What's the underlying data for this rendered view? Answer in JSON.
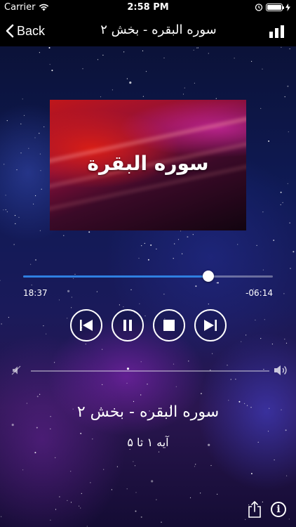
{
  "status_bar": {
    "carrier": "Carrier",
    "time": "2:58 PM",
    "icons": [
      "wifi-icon",
      "alarm-icon",
      "battery-icon",
      "charging-bolt-icon"
    ]
  },
  "nav": {
    "back_label": "Back",
    "title": "سوره البقره - بخش ۲",
    "right_icon": "bar-chart-icon"
  },
  "artwork": {
    "title": "سوره البقرة"
  },
  "player": {
    "elapsed": "18:37",
    "remaining": "-06:14",
    "progress_fraction": 0.741,
    "controls": [
      "previous-track-icon",
      "pause-icon",
      "stop-icon",
      "next-track-icon"
    ],
    "accent_color": "#2f7fe0"
  },
  "volume": {
    "low_icon": "volume-low-icon",
    "high_icon": "volume-high-icon"
  },
  "track": {
    "title": "سوره البقره - بخش ۲",
    "subtitle": "آیه ۱ تا ۵"
  },
  "bottom_icons": [
    "share-icon",
    "info-icon"
  ]
}
